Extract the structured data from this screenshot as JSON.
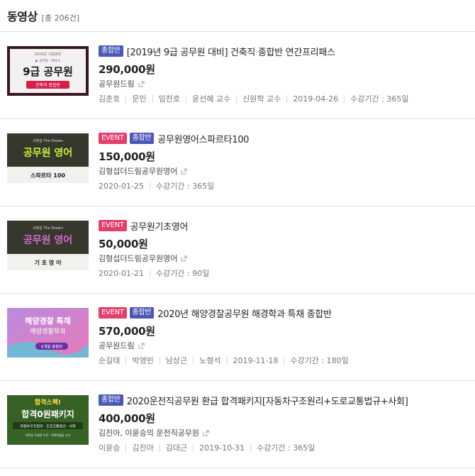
{
  "header": {
    "title": "동영상",
    "count": "[총 206건]"
  },
  "items": [
    {
      "badges": [
        {
          "label": "종합반",
          "type": "combo"
        }
      ],
      "title": "[2019년 9급 공무원 대비] 건축직 종합반 연간프리패스",
      "price": "290,000원",
      "academy": "공무원드림",
      "meta": [
        "김춘호",
        "문민",
        "임찬호",
        "윤선혜 교수",
        "신원학 교수",
        "2019-04-26",
        "수강기간 : 365일"
      ],
      "thumb": {
        "top": "2019년 시험대비",
        "sub": "▶ 공무원 · 대비·A",
        "main": "9급 공무원",
        "tag": "건축직 종합반"
      }
    },
    {
      "badges": [
        {
          "label": "EVENT",
          "type": "event"
        },
        {
          "label": "종합반",
          "type": "combo"
        }
      ],
      "title": "공무원영어스파르타100",
      "price": "150,000원",
      "academy": "김형섭더드림공무원영어",
      "meta": [
        "2020-01-25",
        "수강기간 : 365일"
      ],
      "thumb": {
        "top": "고정섭 The Dream",
        "main": "공무원 영어",
        "tag": "스파르타 100"
      }
    },
    {
      "badges": [
        {
          "label": "EVENT",
          "type": "event"
        }
      ],
      "title": "공무원기초영어",
      "price": "50,000원",
      "academy": "김형섭더드림공무원영어",
      "meta": [
        "2020-01-21",
        "수강기간 : 90일"
      ],
      "thumb": {
        "top": "고정섭 The Dream",
        "main": "공무원 영어",
        "tag": "기 초 영 어"
      }
    },
    {
      "badges": [
        {
          "label": "EVENT",
          "type": "event"
        },
        {
          "label": "종합반",
          "type": "combo"
        }
      ],
      "title": "2020년 해양경찰공무원 해경학과 특채 종합반",
      "price": "570,000원",
      "academy": "공무원드림",
      "meta": [
        "순길태",
        "박영빈",
        "남상근",
        "노형석",
        "2019-11-18",
        "수강기간 : 180일"
      ],
      "thumb": {
        "main": "해양경찰 특채",
        "sub": "해양경찰학과",
        "tag": "6개월 종합반"
      }
    },
    {
      "badges": [
        {
          "label": "종합반",
          "type": "combo"
        }
      ],
      "title": "2020운전직공무원 환급 합격패키지[자동차구조원리+도로교통법규+사회]",
      "price": "400,000원",
      "academy": "김진아, 이윤승의 운전직공무원",
      "meta": [
        "이윤승",
        "김진아",
        "김대근",
        "2019-10-31",
        "수강기간 : 365일"
      ],
      "thumb": {
        "top": "합격스펙!",
        "main": "합격0원패키지",
        "sub": "자동차구조원리 · 도로교통법규 · 사회",
        "foot": "365일 무제한 수강 · 100%환급 조건"
      }
    }
  ],
  "colors": {
    "event": "#e3406c",
    "combo": "#4b58b6"
  }
}
